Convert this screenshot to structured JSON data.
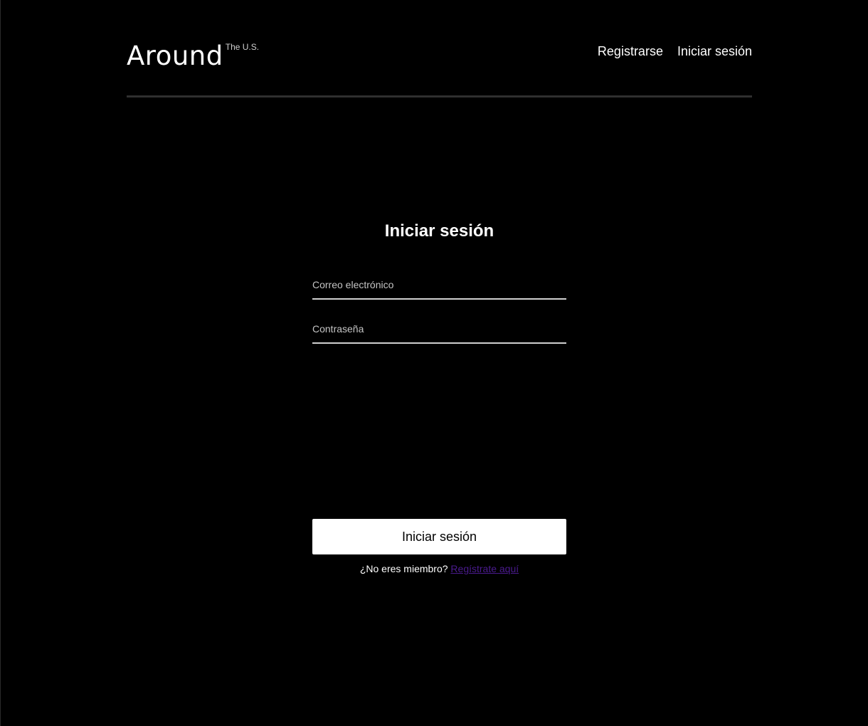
{
  "header": {
    "logo_main": "Around",
    "logo_sup": "The U.S.",
    "nav": [
      {
        "label": "Registrarse"
      },
      {
        "label": "Iniciar sesión"
      }
    ]
  },
  "login": {
    "title": "Iniciar sesión",
    "email_placeholder": "Correo electrónico",
    "email_value": "",
    "password_placeholder": "Contraseña",
    "password_value": "",
    "submit_label": "Iniciar sesión",
    "signup_prompt": "¿No eres miembro?",
    "signup_link": "Regístrate aquí"
  },
  "colors": {
    "background": "#000000",
    "text": "#ffffff",
    "divider": "#2f2f2f",
    "link": "#4b1b8f",
    "button_bg": "#ffffff"
  }
}
